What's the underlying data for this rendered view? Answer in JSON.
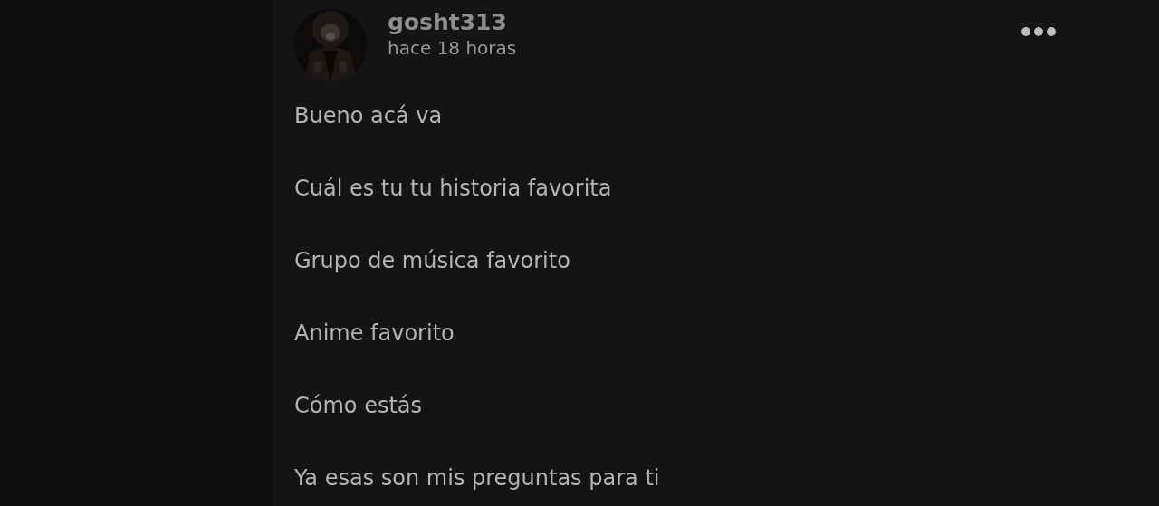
{
  "post": {
    "author": "gosht313",
    "time": "hace 18 horas",
    "paragraphs": [
      "Bueno acá va",
      "Cuál es tu tu historia favorita",
      "Grupo de música favorito",
      "Anime favorito",
      "Cómo estás",
      "Ya esas son mis preguntas para ti"
    ]
  }
}
